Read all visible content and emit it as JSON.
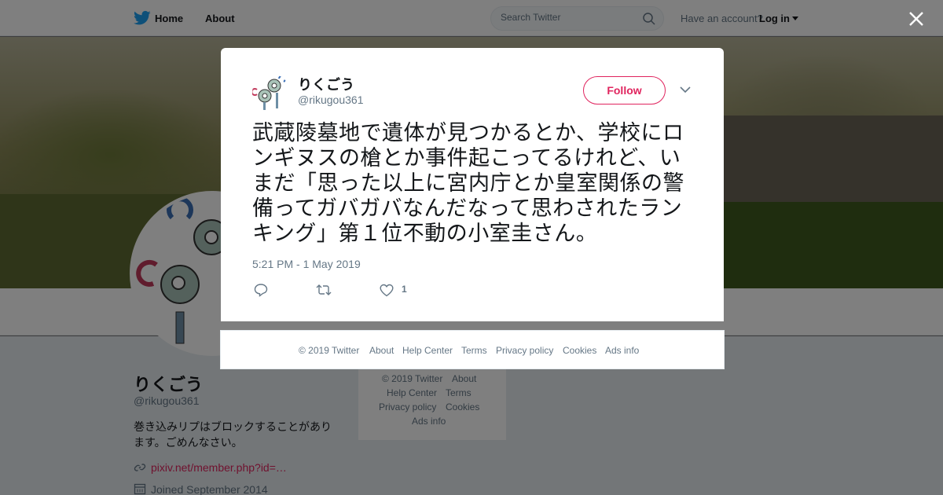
{
  "nav": {
    "home_label": "Home",
    "about_label": "About",
    "search_placeholder": "Search Twitter",
    "account_prompt": "Have an account?",
    "login_label": "Log in"
  },
  "profile": {
    "name": "りくごう",
    "handle": "@rikugou361",
    "bio": "巻き込みリプはブロックすることがあります。ごめんなさい。",
    "link": "pixiv.net/member.php?id=…",
    "joined": "Joined September 2014"
  },
  "side_footer": {
    "copyright": "© 2019 Twitter",
    "about": "About",
    "help": "Help Center",
    "terms": "Terms",
    "privacy": "Privacy policy",
    "cookies": "Cookies",
    "ads": "Ads info"
  },
  "tweet": {
    "author_name": "りくごう",
    "author_handle": "@rikugou361",
    "follow_label": "Follow",
    "text": "武蔵陵墓地で遺体が見つかるとか、学校にロンギヌスの槍とか事件起こってるけれど、いまだ「思った以上に宮内庁とか皇室関係の警備ってガバガバなんだなって思わされたランキング」第１位不動の小室圭さん。",
    "timestamp": "5:21 PM - 1 May 2019",
    "like_count": "1"
  },
  "modal_footer": {
    "copyright": "© 2019 Twitter",
    "about": "About",
    "help": "Help Center",
    "terms": "Terms",
    "privacy": "Privacy policy",
    "cookies": "Cookies",
    "ads": "Ads info"
  },
  "colors": {
    "accent": "#e0245e",
    "twitter_blue": "#1da1f2",
    "muted": "#657786"
  },
  "icons": [
    "twitter-bird-icon",
    "search-icon",
    "close-icon",
    "chevron-down-icon",
    "reply-icon",
    "retweet-icon",
    "like-icon",
    "link-icon",
    "calendar-icon"
  ]
}
